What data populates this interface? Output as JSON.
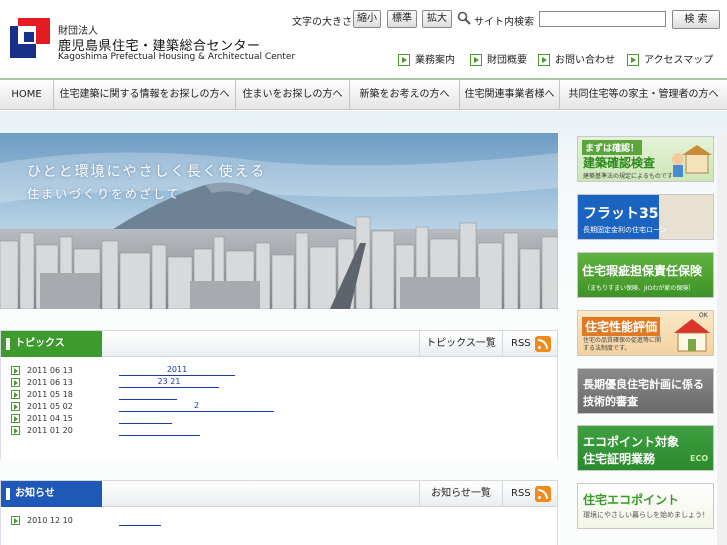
{
  "header": {
    "org_type": "財団法人",
    "org_name": "鹿児島県住宅・建築総合センター",
    "org_name_en": "Kagoshima Prefectual Housing & Architectual Center",
    "font_size_label": "文字の大きさ",
    "font_small": "縮小",
    "font_standard": "標準",
    "font_large": "拡大",
    "search_label": "サイト内検索",
    "search_value": "",
    "search_button": "検 索",
    "utility_links": [
      "業務案内",
      "財団概要",
      "お問い合わせ",
      "アクセスマップ"
    ]
  },
  "global_nav": [
    "HOME",
    "住宅建築に関する情報をお探しの方へ",
    "住まいをお探しの方へ",
    "新築をお考えの方へ",
    "住宅関連事業者様へ",
    "共同住宅等の家主・管理者の方へ"
  ],
  "hero": {
    "line1": "ひとと環境にやさしく長く使える",
    "line2": "住まいづくりをめざして"
  },
  "topics": {
    "title": "トピックス",
    "list_link": "トピックス一覧",
    "rss": "RSS",
    "items": [
      {
        "date": "2011 06 13",
        "title": "2011"
      },
      {
        "date": "2011 06 13",
        "title": "23 21"
      },
      {
        "date": "2011 05 18",
        "title": ""
      },
      {
        "date": "2011 05 02",
        "title": "2"
      },
      {
        "date": "2011 04 15",
        "title": ""
      },
      {
        "date": "2011 01 20",
        "title": ""
      }
    ]
  },
  "notices": {
    "title": "お知らせ",
    "list_link": "お知らせ一覧",
    "rss": "RSS",
    "items": [
      {
        "date": "2010 12 10",
        "title": ""
      }
    ]
  },
  "banners": [
    {
      "t1": "まずは確認！",
      "t2": "建築確認検査",
      "t3": "建築基準法の規定によるものです"
    },
    {
      "t1": "フラット35",
      "t2": "長期固定金利の住宅ローン"
    },
    {
      "t1": "住宅瑕疵担保責任保険",
      "t2": "（まもりすまい保険、JIOわが家の保険）"
    },
    {
      "t1": "住宅性能評価",
      "t2": "住宅の品質確保の促進等に関する法制度です。",
      "badge": "OK"
    },
    {
      "t1": "長期優良住宅計画に係る",
      "t2": "技術的審査"
    },
    {
      "t1": "エコポイント対象",
      "t2": "住宅証明業務",
      "badge": "ECO"
    },
    {
      "t1": "住宅エコポイント",
      "t2": "環境にやさしい暮らしを始めましょう！"
    }
  ],
  "colors": {
    "green": "#3d9a2c",
    "blue": "#1f59b8",
    "link": "#1a3aa8"
  }
}
